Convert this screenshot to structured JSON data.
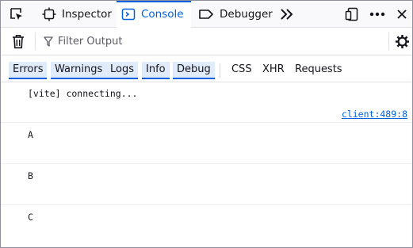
{
  "toolbar": {
    "tabs": [
      {
        "label": "Inspector"
      },
      {
        "label": "Console"
      },
      {
        "label": "Debugger"
      }
    ]
  },
  "filter": {
    "placeholder": "Filter Output"
  },
  "levels": [
    "Errors",
    "Warnings",
    "Logs",
    "Info",
    "Debug"
  ],
  "extra_filters": [
    "CSS",
    "XHR",
    "Requests"
  ],
  "messages": [
    {
      "text": "[vite] connecting...",
      "location": "client:489:8"
    },
    {
      "text": "A"
    },
    {
      "text": "B"
    },
    {
      "text": "C"
    }
  ],
  "colors": {
    "accent": "#0061e0",
    "link": "#0060df"
  }
}
